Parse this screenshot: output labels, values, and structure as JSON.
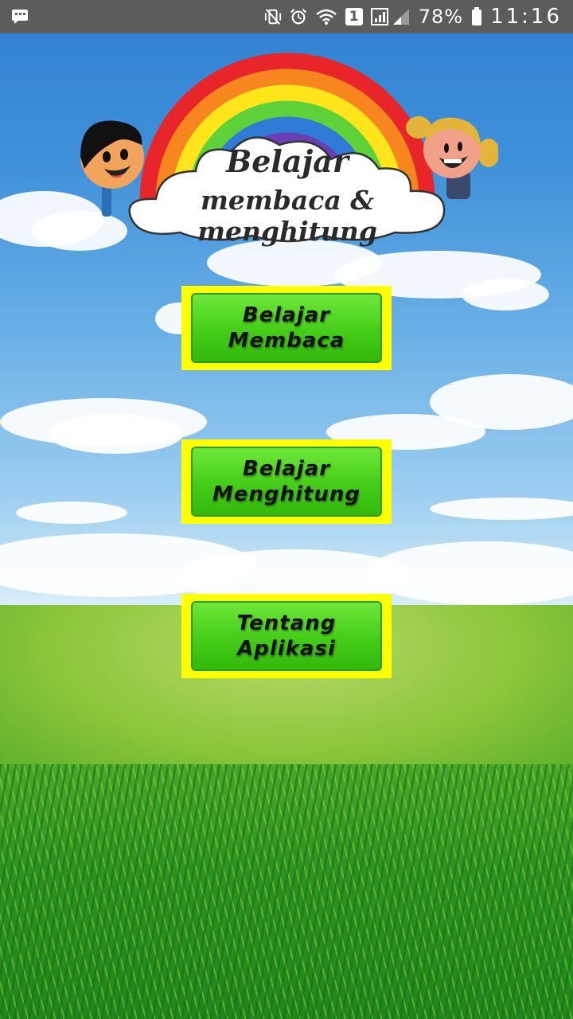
{
  "status_bar": {
    "battery_percent": "78%",
    "time": "11:16",
    "sim_badge": "1",
    "icons": [
      "message-icon",
      "vibrate-mute-icon",
      "alarm-icon",
      "wifi-icon",
      "sim-badge-icon",
      "signal-icon",
      "battery-icon"
    ]
  },
  "banner": {
    "title_line1": "Belajar",
    "title_line2": "membaca & menghitung",
    "rainbow_colors": [
      "#e8262a",
      "#f7861f",
      "#ffe51a",
      "#5fd23a",
      "#2f7bd6",
      "#6a3fb5"
    ]
  },
  "menu": {
    "buttons": [
      {
        "line1": "Belajar",
        "line2": "Membaca"
      },
      {
        "line1": "Belajar",
        "line2": "Menghitung"
      },
      {
        "line1": "Tentang",
        "line2": "Aplikasi"
      }
    ]
  },
  "colors": {
    "button_frame": "#ffff00",
    "button_fill": "#45cc18",
    "status_bar": "#5c5c5c"
  }
}
